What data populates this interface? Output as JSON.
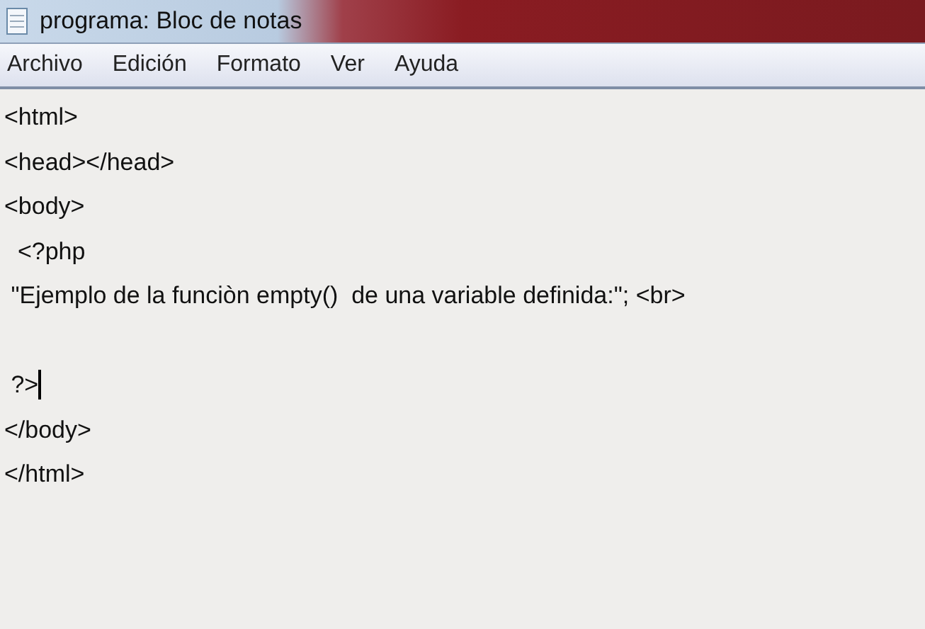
{
  "window": {
    "title": "programa: Bloc de notas"
  },
  "menu": [
    "Archivo",
    "Edición",
    "Formato",
    "Ver",
    "Ayuda"
  ],
  "editor": {
    "lines": [
      {
        "kind": "text",
        "text": "<html>",
        "caret": false
      },
      {
        "kind": "text",
        "text": "<head></head>",
        "caret": false
      },
      {
        "kind": "text",
        "text": "<body>",
        "caret": false
      },
      {
        "kind": "text",
        "text": "  <?php",
        "caret": false
      },
      {
        "kind": "text",
        "text": " \"Ejemplo de la funciòn empty()  de una variable definida:\"; <br>",
        "caret": false
      },
      {
        "kind": "blank",
        "caret": false
      },
      {
        "kind": "text",
        "text": " ?>",
        "caret": true
      },
      {
        "kind": "text",
        "text": "</body>",
        "caret": false
      },
      {
        "kind": "text",
        "text": "</html>",
        "caret": false
      }
    ]
  }
}
